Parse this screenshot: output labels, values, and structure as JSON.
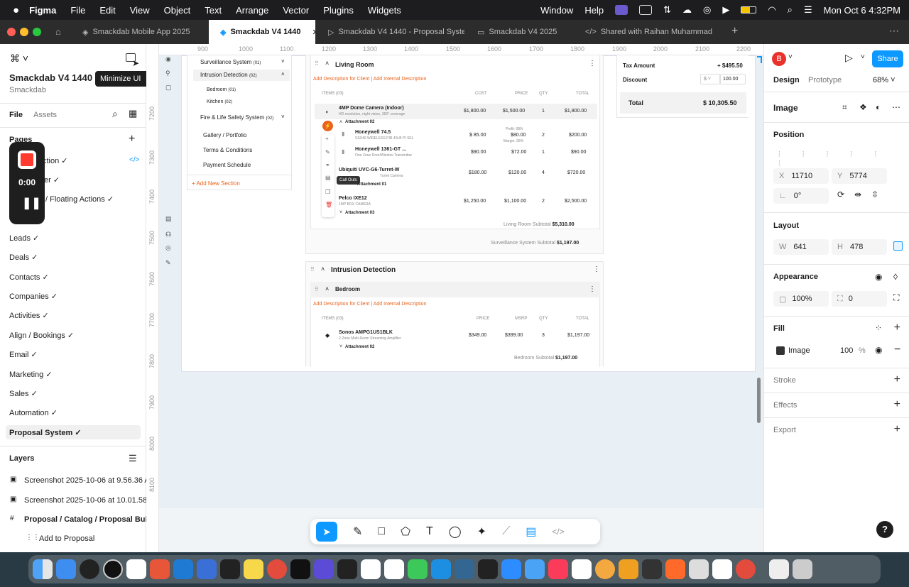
{
  "menubar": {
    "app": "Figma",
    "items": [
      "File",
      "Edit",
      "View",
      "Object",
      "Text",
      "Arrange",
      "Vector",
      "Plugins",
      "Widgets"
    ],
    "right_items": [
      "Window",
      "Help"
    ],
    "clock": "Mon Oct 6  4:32PM"
  },
  "tabs": [
    {
      "label": "Smackdab Mobile App 2025"
    },
    {
      "label": "Smackdab V4 1440"
    },
    {
      "label": "Smackdab V4 1440 - Proposal Syster"
    },
    {
      "label": "Smackdab V4 2025"
    },
    {
      "label": "Shared with Raihan Muhammad"
    }
  ],
  "left": {
    "file_title": "Smackdab V4 1440",
    "team": "Smackdab",
    "tooltip": "Minimize UI",
    "tooltip_shortcut": "⇧⌘\\",
    "file_tab": "File",
    "assets_tab": "Assets",
    "pages_label": "Pages",
    "pages": [
      "ction ✓",
      "er ✓",
      "/ Floating Actions ✓",
      "",
      "Leads ✓",
      "Deals ✓",
      "Contacts ✓",
      "Companies ✓",
      "Activities ✓",
      "Align / Bookings ✓",
      "Email ✓",
      "Marketing ✓",
      "Sales ✓",
      "Automation ✓",
      "Proposal System ✓"
    ],
    "layers_label": "Layers",
    "layers": [
      "Screenshot 2025-10-06 at 9.56.36 AM",
      "Screenshot 2025-10-06 at 10.01.58 AM",
      "Proposal / Catalog / Proposal Builder",
      "Add to Proposal"
    ],
    "recorder_time": "0:00"
  },
  "ruler": {
    "top": [
      "900",
      "1000",
      "1100",
      "1200",
      "1300",
      "1400",
      "1500",
      "1600",
      "1700",
      "1800",
      "1900",
      "2000",
      "2100",
      "2200"
    ],
    "left": [
      "7200",
      "7300",
      "7400",
      "7500",
      "7600",
      "7700",
      "7800",
      "7900",
      "8000",
      "8100"
    ]
  },
  "nav": {
    "items": [
      "Surveillance System",
      "Intrusion Detection",
      "Bedroom",
      "Kitchen",
      "Fire & Life Safety System",
      "Gallery / Portfolio",
      "Terms & Conditions",
      "Payment Schedule"
    ],
    "counts": [
      "(01)",
      "(02)",
      "(01)",
      "(02)",
      "(02)"
    ],
    "add": "+ Add New Section"
  },
  "living": {
    "title": "Living Room",
    "desc": "Add Description for Client | Add Internal Description",
    "cols": [
      "ITEMS (03)",
      "COST",
      "PRICE",
      "QTY",
      "TOTAL"
    ],
    "rows": [
      {
        "name": "4MP Dome Camera (Indoor)",
        "sub": "HD resolution, night vision, 360° coverage",
        "cost": "$1,800.00",
        "price": "$1,500.00",
        "qty": "1",
        "total": "$1,800.00"
      },
      {
        "name": "Honeywell 74.5",
        "sub": "SSX40 WIRELESS PIR 40LB PI SEL",
        "cost": "$ 85.00",
        "price": "$80.00",
        "qty": "2",
        "total": "$200.00"
      },
      {
        "name": "Honeywell 1361-GT ...",
        "sub": "One Zone Door/Window Transmitter",
        "cost": "$90.00",
        "price": "$72.00",
        "qty": "1",
        "total": "$90.00"
      },
      {
        "name": "Ubiquiti UVC-G6-Turret-W",
        "sub": "Turret Camera",
        "cost": "$180.00",
        "price": "$120.00",
        "qty": "4",
        "total": "$720.00"
      },
      {
        "name": "Pelco IXE12",
        "sub": "1MP BOX CAMERA",
        "cost": "$1,250.00",
        "price": "$1,100.00",
        "qty": "2",
        "total": "$2,500.00"
      }
    ],
    "attach1": "Attachment 02",
    "attach2": "Attachment 01",
    "attach3": "Attachment 03",
    "profit": "Profit: 08%",
    "margin": "Margin: 35%",
    "callout": "Call Outs",
    "subtotal_label": "Living Room Subtotal",
    "subtotal": "$5,310.00",
    "sys_label": "Surveillance System Subtotal",
    "sys": "$1,197.00"
  },
  "intrusion": {
    "title": "Intrusion Detection"
  },
  "bedroom": {
    "title": "Bedroom",
    "desc": "Add Description for Client | Add Internal Description",
    "cols": [
      "ITEMS (03)",
      "PRICE",
      "MSRP",
      "QTY",
      "TOTAL"
    ],
    "row": {
      "name": "Sonos AMPG1US1BLK",
      "sub": "2-Zone Multi-Room Streaming Amplifier",
      "price": "$349.00",
      "msrp": "$399.00",
      "qty": "3",
      "total": "$1,197.00"
    },
    "attach": "Attachment 02",
    "subtotal_label": "Bedroom Subtotal",
    "subtotal": "$1,197.00"
  },
  "summary": {
    "tax_label": "Tax Amount",
    "tax": "+ $495.50",
    "discount_label": "Discount",
    "discount_unit": "$",
    "discount": "100.00",
    "total_label": "Total",
    "total": "$ 10,305.50"
  },
  "right": {
    "avatar": "B",
    "share": "Share",
    "design_tab": "Design",
    "prototype_tab": "Prototype",
    "zoom": "68%",
    "selection": "Image",
    "position_label": "Position",
    "x": "11710",
    "y": "5774",
    "rotation": "0°",
    "layout_label": "Layout",
    "w": "641",
    "h": "478",
    "appearance_label": "Appearance",
    "opacity": "100%",
    "radius": "0",
    "fill_label": "Fill",
    "fill_name": "Image",
    "fill_opacity": "100",
    "fill_pct": "%",
    "stroke_label": "Stroke",
    "effects_label": "Effects",
    "export_label": "Export",
    "help": "?"
  },
  "colors": {
    "accent": "#e8631c",
    "blue": "#0d99ff"
  }
}
